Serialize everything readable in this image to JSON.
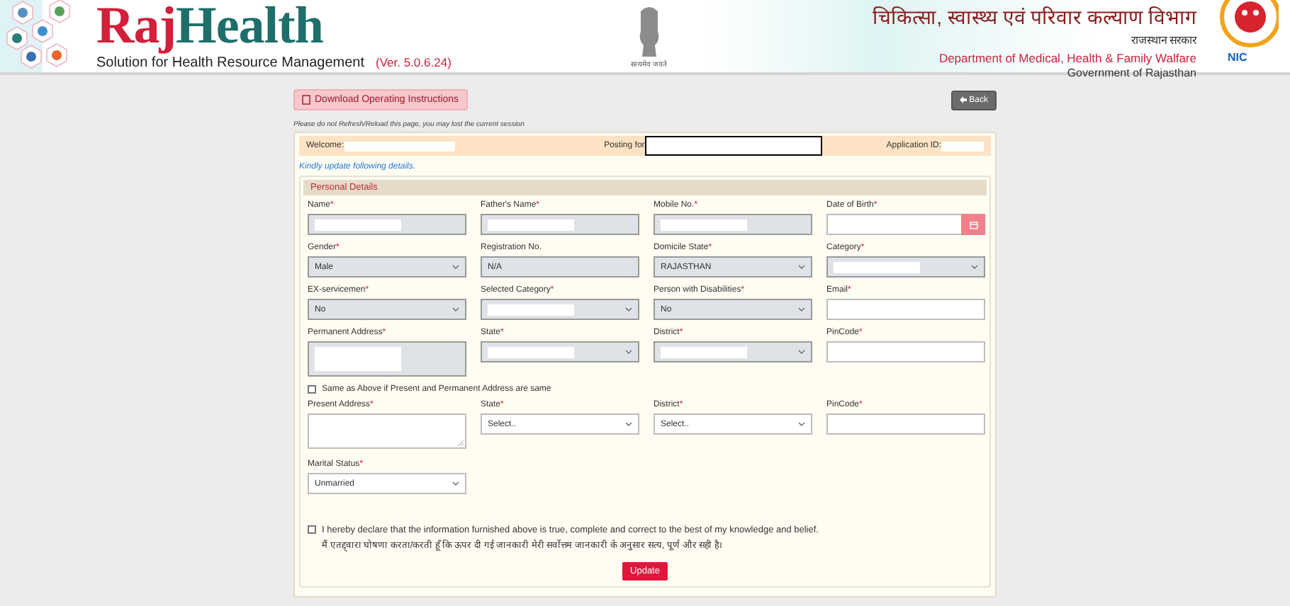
{
  "header": {
    "brand_first": "Raj",
    "brand_second": "Health",
    "tagline": "Solution for Health Resource Management",
    "version": "(Ver. 5.0.6.24)",
    "emblem_caption": "सत्यमेव जयते",
    "dept_hindi": "चिकित्सा, स्वास्थ्य एवं परिवार कल्याण विभाग",
    "govt_hindi": "राजस्थान सरकार",
    "dept_english": "Department of Medical, Health & Family Walfare",
    "govt_english": "Government of Rajasthan",
    "partner_badge": "NIC"
  },
  "toolbar": {
    "download_button": "Download Operating Instructions",
    "back_button": "Back"
  },
  "notice": "Please do not Refresh/Reload this page, you may lost the current session",
  "session_bar": {
    "welcome_label": "Welcome:",
    "welcome_redacted": true,
    "posting_label": "Posting for",
    "posting_redacted": true,
    "application_label": "Application ID:",
    "application_redacted": true
  },
  "instruction": "Kindly update following details.",
  "section": {
    "title": "Personal Details",
    "required_mark": "*",
    "rows": [
      [
        {
          "label": "Name",
          "required": true,
          "kind": "text",
          "disabled": true,
          "redacted": true
        },
        {
          "label": "Father's Name",
          "required": true,
          "kind": "text",
          "disabled": true,
          "redacted": true
        },
        {
          "label": "Mobile No.",
          "required": true,
          "kind": "text",
          "disabled": true,
          "redacted": true
        },
        {
          "label": "Date of Birth",
          "required": true,
          "kind": "date",
          "disabled": false
        }
      ],
      [
        {
          "label": "Gender",
          "required": true,
          "kind": "select",
          "disabled": true,
          "value": "Male"
        },
        {
          "label": "Registration No.",
          "required": false,
          "kind": "text",
          "disabled": true,
          "value": "N/A"
        },
        {
          "label": "Domicile State",
          "required": true,
          "kind": "select",
          "disabled": true,
          "value": "RAJASTHAN"
        },
        {
          "label": "Category",
          "required": true,
          "kind": "select",
          "disabled": true,
          "redacted": true
        }
      ],
      [
        {
          "label": "EX-servicemen",
          "required": true,
          "kind": "select",
          "disabled": true,
          "value": "No"
        },
        {
          "label": "Selected Category",
          "required": true,
          "kind": "select",
          "disabled": true,
          "redacted": true
        },
        {
          "label": "Person with Disabilities",
          "required": true,
          "kind": "select",
          "disabled": true,
          "value": "No"
        },
        {
          "label": "Email",
          "required": true,
          "kind": "text",
          "disabled": false
        }
      ],
      [
        {
          "label": "Permanent Address",
          "required": true,
          "kind": "textarea",
          "disabled": true,
          "redacted": true
        },
        {
          "label": "State",
          "required": true,
          "kind": "select",
          "disabled": true,
          "redacted": true
        },
        {
          "label": "District",
          "required": true,
          "kind": "select",
          "disabled": true,
          "redacted": true
        },
        {
          "label": "PinCode",
          "required": true,
          "kind": "text",
          "disabled": false
        }
      ]
    ],
    "same_address": {
      "label": "Same as Above if Present and Permanent Address are same",
      "checked": false
    },
    "present_row": [
      {
        "label": "Present Address",
        "required": true,
        "kind": "textarea",
        "disabled": false
      },
      {
        "label": "State",
        "required": true,
        "kind": "select",
        "disabled": false,
        "value": "Select.."
      },
      {
        "label": "District",
        "required": true,
        "kind": "select",
        "disabled": false,
        "value": "Select.."
      },
      {
        "label": "PinCode",
        "required": true,
        "kind": "text",
        "disabled": false
      }
    ],
    "marital": {
      "label": "Marital Status",
      "required": true,
      "kind": "select",
      "disabled": false,
      "value": "Unmarried"
    },
    "declaration": {
      "checked": false,
      "english": "I hereby declare that the information furnished above is true, complete and correct to the best of my knowledge and belief.",
      "hindi": "मैं एतद्द्वारा घोषणा करता/करती हूँ कि ऊपर दी गई जानकारी मेरी सर्वोत्तम जानकारी के अनुसार सत्य, पूर्ण और सही है।"
    },
    "submit_button": "Update"
  }
}
